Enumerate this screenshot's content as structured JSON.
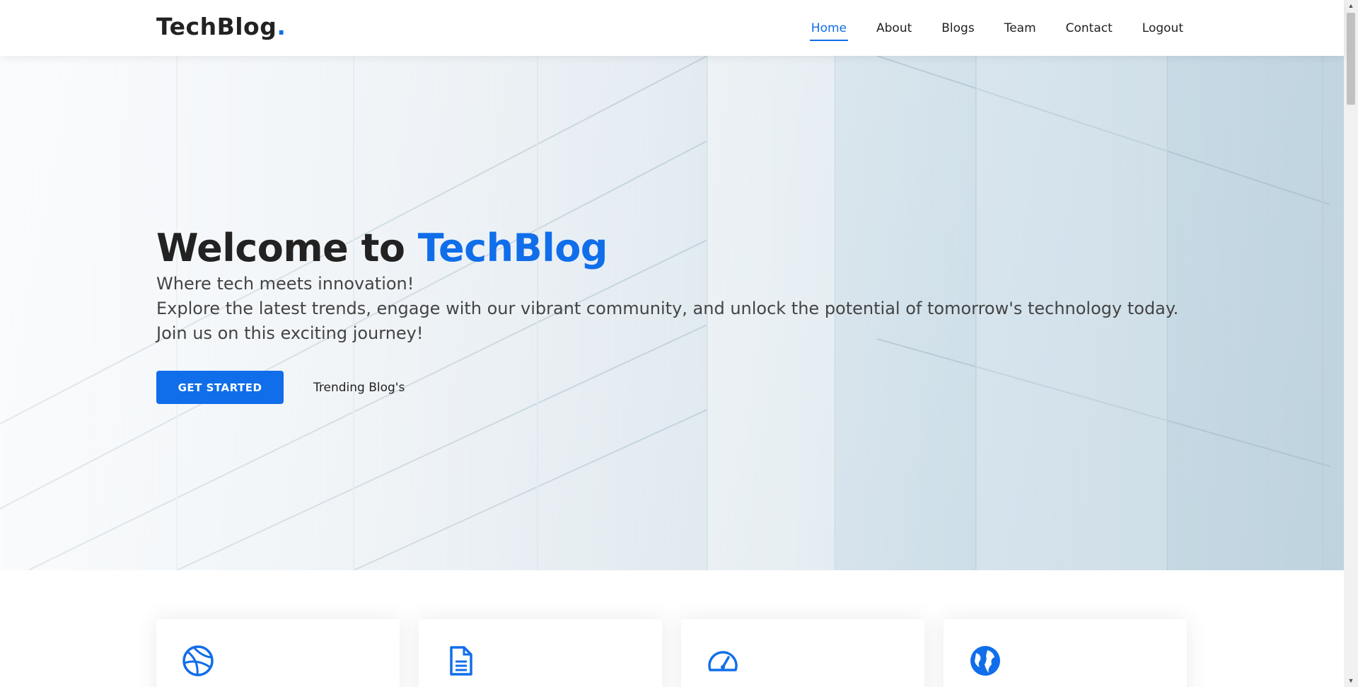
{
  "brand": {
    "name": "TechBlog",
    "dot": ".",
    "accent_color": "#106eea"
  },
  "nav": {
    "items": [
      {
        "label": "Home",
        "active": true
      },
      {
        "label": "About"
      },
      {
        "label": "Blogs"
      },
      {
        "label": "Team"
      },
      {
        "label": "Contact"
      },
      {
        "label": "Logout"
      }
    ]
  },
  "hero": {
    "title_prefix": "Welcome to ",
    "title_accent": "TechBlog",
    "line1": "Where tech meets innovation!",
    "line2": "Explore the latest trends, engage with our vibrant community, and unlock the potential of tomorrow's technology today.",
    "line3": "Join us on this exciting journey!",
    "cta_primary": "GET STARTED",
    "cta_secondary": "Trending Blog's"
  },
  "features": {
    "icons": [
      "basketball-icon",
      "document-icon",
      "speedometer-icon",
      "globe-icon"
    ]
  }
}
